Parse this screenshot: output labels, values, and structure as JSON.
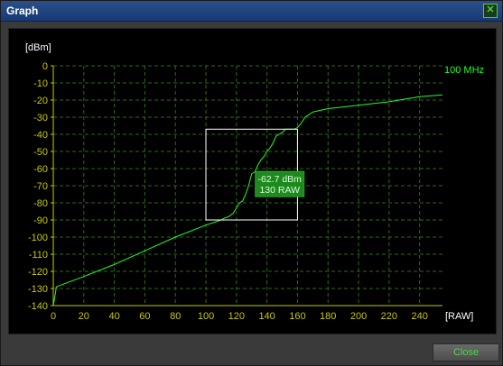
{
  "window": {
    "title": "Graph",
    "close_icon": "close-icon"
  },
  "footer": {
    "close_label": "Close"
  },
  "colors": {
    "axis": "#c8c800",
    "grid": "#2e6a1a",
    "line": "#22ff22",
    "tooltip_bg": "#1e8a1e",
    "selection": "#ffffff"
  },
  "chart_data": {
    "type": "line",
    "xlabel": "[RAW]",
    "ylabel": "[dBm]",
    "xlim": [
      0,
      255
    ],
    "ylim": [
      -140,
      0
    ],
    "x_ticks": [
      0,
      20,
      40,
      60,
      80,
      100,
      120,
      140,
      160,
      180,
      200,
      220,
      240
    ],
    "y_ticks": [
      0,
      -10,
      -20,
      -30,
      -40,
      -50,
      -60,
      -70,
      -80,
      -90,
      -100,
      -110,
      -120,
      -130,
      -140
    ],
    "grid": true,
    "series": [
      {
        "name": "100 MHz",
        "x": [
          0,
          1,
          2,
          5,
          20,
          40,
          60,
          80,
          100,
          110,
          112,
          115,
          118,
          120,
          122,
          124,
          126,
          128,
          130,
          132,
          134,
          136,
          138,
          140,
          142,
          144,
          146,
          148,
          150,
          152,
          154,
          156,
          158,
          160,
          162,
          165,
          170,
          175,
          180,
          190,
          200,
          220,
          240,
          255
        ],
        "y": [
          -140,
          -135,
          -129,
          -128,
          -123,
          -116,
          -108,
          -100,
          -93,
          -90,
          -89,
          -88,
          -86,
          -83,
          -80,
          -79,
          -75,
          -70,
          -63,
          -62,
          -58,
          -55,
          -53,
          -50,
          -48,
          -45,
          -41,
          -40,
          -39,
          -37,
          -37,
          -37,
          -37,
          -36,
          -34,
          -30,
          -27,
          -26,
          -25,
          -24,
          -23,
          -21,
          -18,
          -17
        ]
      }
    ],
    "annotations": [
      {
        "text": "-62.7 dBm",
        "x": 130,
        "y": -62.7
      },
      {
        "text": "130 RAW",
        "x": 130,
        "y": -62.7
      }
    ],
    "selection_box": {
      "x": [
        100,
        160
      ],
      "y": [
        -90,
        -37
      ]
    }
  }
}
